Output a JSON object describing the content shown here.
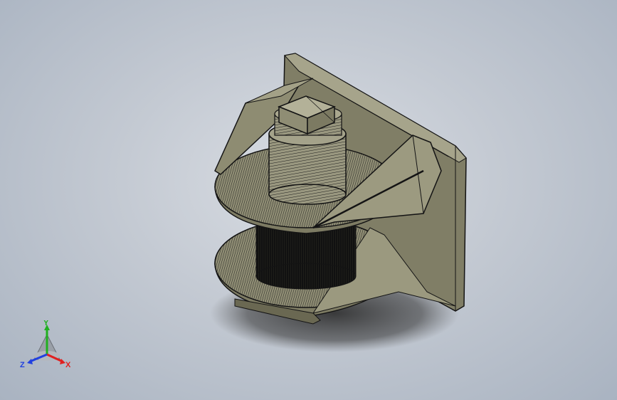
{
  "viewport": {
    "background_top": "#d9dde3",
    "background_bottom": "#a9b3c1"
  },
  "model": {
    "name_icon": "part-model-icon",
    "face_color": "#8c8a6e",
    "edge_color": "#141414",
    "dark_color": "#0d0d0d"
  },
  "triad": {
    "x_label": "X",
    "y_label": "Y",
    "z_label": "Z",
    "x_color": "#e02020",
    "y_color": "#20b020",
    "z_color": "#2040e0"
  }
}
